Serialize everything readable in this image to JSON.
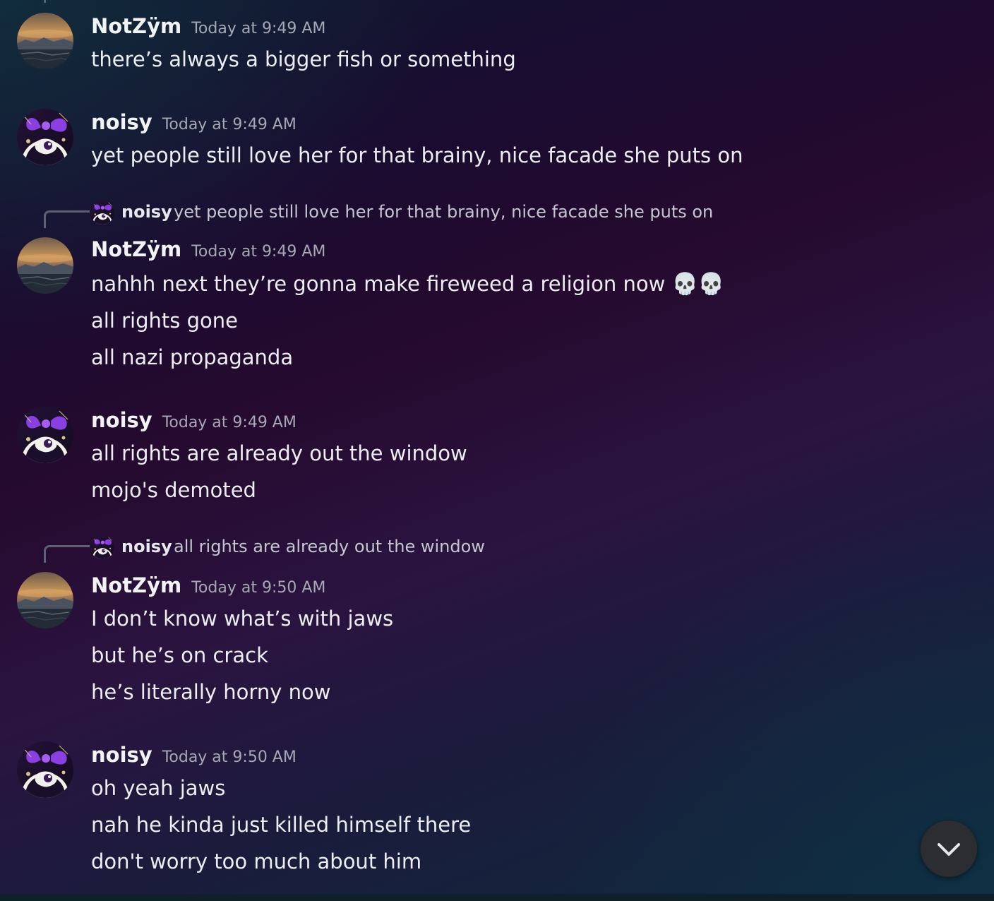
{
  "messages": [
    {
      "author": "NotZÿm",
      "avatar_icon": "landscape-avatar-icon",
      "timestamp": "Today at 9:49 AM",
      "lines": [
        "there’s always a bigger fish or something"
      ]
    },
    {
      "author": "noisy",
      "avatar_icon": "bow-character-avatar-icon",
      "timestamp": "Today at 9:49 AM",
      "lines": [
        "yet people still love her for that brainy, nice facade she puts on"
      ]
    },
    {
      "reply": {
        "author": "noisy",
        "text": "yet people still love her for that brainy, nice facade she puts on"
      },
      "author": "NotZÿm",
      "avatar_icon": "landscape-avatar-icon",
      "timestamp": "Today at 9:49 AM",
      "lines": [
        "nahhh next they’re gonna make fireweed a religion now",
        "all rights gone",
        "all nazi propaganda"
      ],
      "emoji": "💀💀"
    },
    {
      "author": "noisy",
      "avatar_icon": "bow-character-avatar-icon",
      "timestamp": "Today at 9:49 AM",
      "lines": [
        "all rights are already out the window",
        "mojo's demoted"
      ]
    },
    {
      "reply": {
        "author": "noisy",
        "text": "all rights are already out the window"
      },
      "author": "NotZÿm",
      "avatar_icon": "landscape-avatar-icon",
      "timestamp": "Today at 9:50 AM",
      "lines": [
        "I don’t know what’s with jaws",
        "but he’s on crack",
        "he’s literally horny now"
      ]
    },
    {
      "author": "noisy",
      "avatar_icon": "bow-character-avatar-icon",
      "timestamp": "Today at 9:50 AM",
      "lines": [
        "oh yeah jaws",
        "nah he kinda just killed himself there",
        "don't worry too much about him"
      ]
    }
  ],
  "scroll_button": {
    "icon": "chevron-down-icon"
  },
  "colors": {
    "username": "#f2f3f5",
    "timestamp": "#a6a8b4",
    "message_text": "#eceef2",
    "reply_spine": "#5d6070",
    "scroll_button_bg": "#2b2d31"
  }
}
